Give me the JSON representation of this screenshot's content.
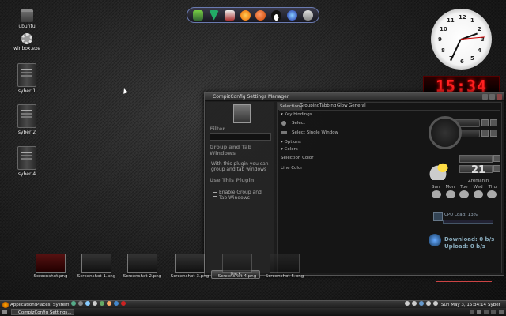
{
  "desktop": {
    "icons": [
      {
        "label": "ubuntu",
        "type": "folder-icon"
      },
      {
        "label": "winbox.exe",
        "type": "gear-icon"
      },
      {
        "label": "syber 1",
        "type": "computer-icon"
      },
      {
        "label": "syber 2",
        "type": "computer-icon"
      },
      {
        "label": "syber 4",
        "type": "computer-icon"
      }
    ]
  },
  "dock": {
    "items": [
      "app-icon",
      "green-app-icon",
      "media-icon",
      "firefox-icon",
      "ball-icon",
      "tux-icon",
      "globe-icon",
      "hdd-icon"
    ]
  },
  "clock": {
    "numbers": [
      "12",
      "1",
      "2",
      "3",
      "4",
      "5",
      "6",
      "7",
      "8",
      "9",
      "10",
      "11"
    ]
  },
  "digital_clock": {
    "time": "15:34"
  },
  "window": {
    "title": "CompizConfig Settings Manager",
    "left": {
      "filter_label": "Filter",
      "plugin_title": "Group and Tab Windows",
      "plugin_desc": "With this plugin you can group and tab windows",
      "use_title": "Use This Plugin",
      "enable_label": "Enable Group and Tab Windows",
      "back_label": "Back"
    },
    "tabs": [
      "Selection",
      "Grouping",
      "Tabbing",
      "Glow",
      "General"
    ],
    "sections": {
      "key_bindings": "Key bindings",
      "select": "Select",
      "select_single": "Select Single Window",
      "options": "Options",
      "colors": "Colors",
      "selection_color": "Selection Color",
      "line_color": "Line Color"
    }
  },
  "widgets": {
    "temperature": "21",
    "weather_location": "Zrenjanin",
    "weather_days": [
      "Sun",
      "Mon",
      "Tue",
      "Wed",
      "Thu"
    ],
    "cpu": "CPU Load: 13%",
    "download": "Download: 0 b/s",
    "upload": "Upload: 0 b/s"
  },
  "thumbnails": [
    "Screenshot.png",
    "Screenshot-1.png",
    "Screenshot-2.png",
    "Screenshot-3.png",
    "Screenshot-4.png",
    "Screenshot-5.png"
  ],
  "panel": {
    "menus": [
      "Applications",
      "Places",
      "System"
    ],
    "datetime": "Sun May 3, 15:34:14",
    "user": "Syber"
  },
  "taskbar": {
    "task": "CompizConfig Settings..."
  }
}
